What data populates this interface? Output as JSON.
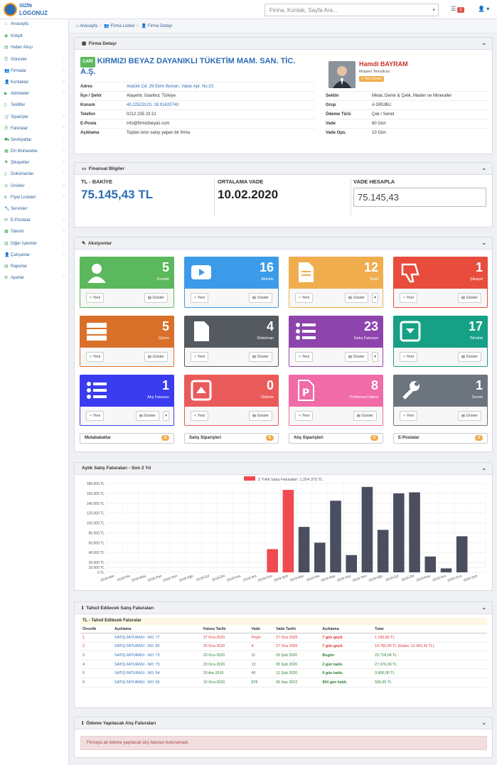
{
  "topbar": {
    "logo_line1": "SİZİN",
    "logo_line2": "LOGONUZ",
    "search_placeholder": "Firma, Kontak, Sayfa Ara...",
    "list_badge": "2"
  },
  "sidebar": {
    "items": [
      {
        "label": "Anasayfa",
        "icon": "home-icon",
        "chevron": false
      },
      {
        "label": "Kokpit",
        "icon": "dashboard-icon",
        "chevron": false
      },
      {
        "label": "Haber Akışı",
        "icon": "news-icon",
        "chevron": false
      },
      {
        "label": "Görevler",
        "icon": "tasks-icon",
        "chevron": true
      },
      {
        "label": "Firmalar",
        "icon": "users-icon",
        "chevron": true
      },
      {
        "label": "Kontaklar",
        "icon": "contacts-icon",
        "chevron": true
      },
      {
        "label": "Aktiviteler",
        "icon": "video-icon",
        "chevron": true
      },
      {
        "label": "Teklifler",
        "icon": "file-icon",
        "chevron": true
      },
      {
        "label": "Siparişler",
        "icon": "cart-icon",
        "chevron": true
      },
      {
        "label": "Faturalar",
        "icon": "invoice-icon",
        "chevron": true
      },
      {
        "label": "Sevkiyatlar",
        "icon": "truck-icon",
        "chevron": true
      },
      {
        "label": "Ön Muhasebe",
        "icon": "accounting-icon",
        "chevron": true
      },
      {
        "label": "Şikayetler",
        "icon": "complaint-icon",
        "chevron": true
      },
      {
        "label": "Dokümanlar",
        "icon": "document-icon",
        "chevron": true
      },
      {
        "label": "Ürünler",
        "icon": "product-icon",
        "chevron": true
      },
      {
        "label": "Fiyat Listeleri",
        "icon": "pricelist-icon",
        "chevron": true
      },
      {
        "label": "Servisler",
        "icon": "wrench-icon",
        "chevron": true
      },
      {
        "label": "E-Postalar",
        "icon": "mail-icon",
        "chevron": true
      },
      {
        "label": "Takvim",
        "icon": "calendar-icon",
        "chevron": true
      },
      {
        "label": "Diğer İşlemler",
        "icon": "other-icon",
        "chevron": true
      },
      {
        "label": "Çalışanlar",
        "icon": "employee-icon",
        "chevron": true
      },
      {
        "label": "Raporlar",
        "icon": "report-icon",
        "chevron": false
      },
      {
        "label": "Ayarlar",
        "icon": "settings-icon",
        "chevron": true
      }
    ]
  },
  "breadcrumb": {
    "home": "Anasayfa",
    "list": "Firma Listesi",
    "current": "Firma Detayı"
  },
  "firm": {
    "panel_title": "Firma Detayı",
    "tag": "CARİ",
    "name": "KIRMIZI BEYAZ DAYANIKLI TÜKETİM MAM. SAN. TİC. A.Ş.",
    "rows": [
      {
        "k": "Adres",
        "v": "Atatürk Cd. 29 Ekim Bulvarı. Vatan Apt. No:23"
      },
      {
        "k": "İlçe / Şehir",
        "v": "Ataşehir, İstanbul, Türkiye"
      },
      {
        "k": "Konum",
        "v": "40.22523120, 28.91420740"
      },
      {
        "k": "Telefon",
        "v": "0212 235 23 21"
      },
      {
        "k": "E-Posta",
        "v": "info@firmizibeyaz.com"
      },
      {
        "k": "Açıklama",
        "v": "Toptan ürün satışı yapan bir firma"
      }
    ],
    "rep_name": "Hamdi BAYRAM",
    "rep_title": "Müşteri Temsilcisi",
    "rep_button": "Yeni Görev",
    "rows2": [
      {
        "k": "Sektör",
        "v": "Metal, Demir & Çelik, Maden ve Mineraller"
      },
      {
        "k": "Grup",
        "v": "A GRUBU"
      },
      {
        "k": "Ödeme Türü",
        "v": "Çek / Senet"
      },
      {
        "k": "Vade",
        "v": "60 Gün"
      },
      {
        "k": "Vade Ops.",
        "v": "10 Gün"
      }
    ]
  },
  "finance": {
    "panel_title": "Finansal Bilgiler",
    "balance_label": "TL - BAKİYE",
    "balance": "75.145,43 TL",
    "avg_label": "ORTALAMA VADE",
    "avg": "10.02.2020",
    "calc_label": "VADE HESAPLA",
    "calc_value": "75.145,43"
  },
  "actions": {
    "panel_title": "Aksiyonlar",
    "new_label": "Yeni",
    "show_label": "Göster",
    "cards": [
      {
        "count": "5",
        "label": "Kontak",
        "color": "#5cb85c",
        "icon": "user-icon"
      },
      {
        "count": "16",
        "label": "Aktivite",
        "color": "#3c9be8",
        "icon": "play-icon"
      },
      {
        "count": "12",
        "label": "Teklif",
        "color": "#f0ad4e",
        "icon": "file-icon"
      },
      {
        "count": "1",
        "label": "Şikayet",
        "color": "#e74c3c",
        "icon": "thumbs-down-icon"
      },
      {
        "count": "5",
        "label": "Görev",
        "color": "#d9702a",
        "icon": "tasks-icon"
      },
      {
        "count": "4",
        "label": "Doküman",
        "color": "#555a60",
        "icon": "document-icon"
      },
      {
        "count": "23",
        "label": "Satış Faturası",
        "color": "#8e44ad",
        "icon": "list-icon"
      },
      {
        "count": "17",
        "label": "Tahsilat",
        "color": "#16a085",
        "icon": "box-icon"
      },
      {
        "count": "1",
        "label": "Alış Faturası",
        "color": "#3b3bef",
        "icon": "list-icon"
      },
      {
        "count": "0",
        "label": "Ödeme",
        "color": "#e95a5a",
        "icon": "upload-icon"
      },
      {
        "count": "8",
        "label": "Proforma Fatura",
        "color": "#f06ba8",
        "icon": "p-icon"
      },
      {
        "count": "1",
        "label": "Servis",
        "color": "#6c757d",
        "icon": "wrench-icon"
      }
    ],
    "summaries": [
      {
        "label": "Mutabakatlar",
        "count": "0"
      },
      {
        "label": "Satış Siparişleri",
        "count": "6"
      },
      {
        "label": "Alış Siparişleri",
        "count": "0"
      },
      {
        "label": "E-Postalar",
        "count": "0"
      }
    ]
  },
  "chart_section": {
    "panel_title": "Aylık Satış Faturaları - Son 2 Yıl"
  },
  "chart_data": {
    "type": "bar",
    "legend": "2 Yıllık Satış Faturaları: 1.254.373 TL",
    "categories": [
      "2018-Mar",
      "2018-Nis",
      "2018-May",
      "2018-Haz",
      "2018-Tem",
      "2018-Ağu",
      "2018-Eyl",
      "2018-Eki",
      "2018-Kas",
      "2018-Ara",
      "2019-Oca",
      "2019-Şub",
      "2019-Mar",
      "2019-Nis",
      "2019-May",
      "2019-Haz",
      "2019-Tem",
      "2019-Ağu",
      "2019-Eyl",
      "2019-Eki",
      "2019-Kas",
      "2019-Ara",
      "2020-Oca",
      "2020-Şub"
    ],
    "values": [
      0,
      0,
      0,
      0,
      0,
      0,
      0,
      0,
      0,
      0,
      47000,
      167000,
      92000,
      60000,
      145000,
      35000,
      173000,
      86000,
      160000,
      162000,
      32000,
      8000,
      73000,
      0
    ],
    "highlight": [
      10,
      11
    ],
    "highlight_color": "#f04a50",
    "bar_color": "#4a4e5e",
    "yticks": [
      "0 TL",
      "10.000 TL",
      "20.000 TL",
      "40.000 TL",
      "60.000 TL",
      "80.000 TL",
      "100.000 TL",
      "120.000 TL",
      "140.000 TL",
      "160.000 TL",
      "180.000 TL"
    ],
    "ylim": [
      0,
      180000
    ],
    "grid": true,
    "legend_position": "top"
  },
  "collect": {
    "panel_title": "Tahsil Edilecek Satış Faturaları",
    "sub_title": "TL - Tahsil Edilecek Faturalar",
    "headers": [
      "Öncelik",
      "Açıklama",
      "Fatura Tarihi",
      "Vade",
      "Vade Tarihi",
      "Açıklama",
      "Tutar"
    ],
    "rows": [
      [
        "1",
        "SATIŞ FATURASI - NO: 77",
        "27 Oca 2020",
        "Peşin",
        "27 Oca 2020",
        "7 gün geçti.",
        "1.160,00 TL"
      ],
      [
        "2",
        "SATIŞ FATURASI - NO: 82",
        "23 Oca 2020",
        "4",
        "27 Oca 2020",
        "7 gün geçti.",
        "14.750,00 TL (Kalan: 12.491,43 TL)"
      ],
      [
        "3",
        "SATIŞ FATURASI - NO: 73",
        "23 Oca 2020",
        "11",
        "03 Şub 2020",
        "Bugün",
        "23.718,00 TL"
      ],
      [
        "4",
        "SATIŞ FATURASI - NO: 75",
        "23 Oca 2020",
        "13",
        "05 Şub 2020",
        "2 gün kaldı.",
        "27.376,00 TL"
      ],
      [
        "5",
        "SATIŞ FATURASI - NO: 54",
        "29 Ara 2019",
        "45",
        "12 Şub 2020",
        "9 gün kaldı.",
        "9.800,00 TL"
      ],
      [
        "6",
        "SATIŞ FATURASI - NO: 55",
        "10 Oca 2020",
        "878",
        "06 Haz 2022",
        "854 gün kaldı.",
        "590,00 TL"
      ]
    ],
    "row_colors": [
      "#e03030",
      "#e03030",
      "#2e7d32",
      "#2e7d32",
      "#2e7d32",
      "#2e7d32"
    ]
  },
  "pay": {
    "panel_title": "Ödeme Yapılacak Alış Faturaları",
    "message": "Firmaya ait ödeme yapılacak alış faturası bulunamadı."
  }
}
